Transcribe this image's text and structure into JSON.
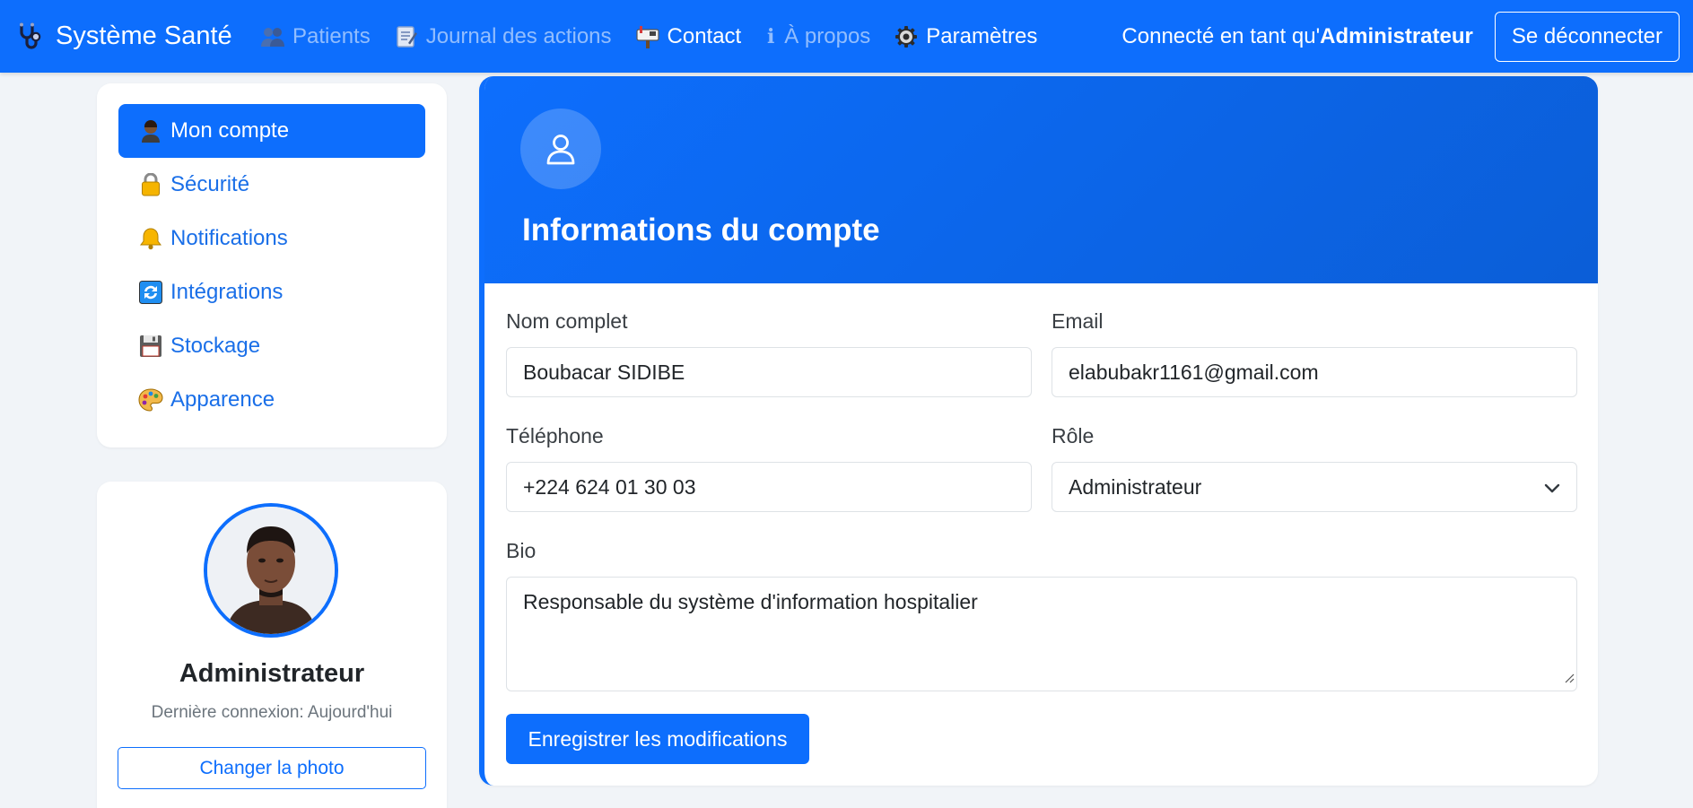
{
  "navbar": {
    "brand_title": "Système Santé",
    "brand_icon": "stethoscope-icon",
    "links": [
      {
        "label": "Patients",
        "icon": "users-icon"
      },
      {
        "label": "Journal des actions",
        "icon": "memo-icon"
      },
      {
        "label": "Contact",
        "icon": "mailbox-icon"
      },
      {
        "label": "À propos",
        "icon": "info-icon"
      },
      {
        "label": "Paramètres",
        "icon": "gear-icon"
      }
    ],
    "logged_prefix": "Connecté en tant qu'",
    "logged_user": "Administrateur",
    "logout_label": "Se déconnecter",
    "colors": {
      "primary": "#0d6efd"
    }
  },
  "sidebar": {
    "menu": [
      {
        "label": "Mon compte",
        "icon": "user-icon",
        "active": true
      },
      {
        "label": "Sécurité",
        "icon": "lock-icon",
        "active": false
      },
      {
        "label": "Notifications",
        "icon": "bell-icon",
        "active": false
      },
      {
        "label": "Intégrations",
        "icon": "sync-icon",
        "active": false
      },
      {
        "label": "Stockage",
        "icon": "floppy-disk-icon",
        "active": false
      },
      {
        "label": "Apparence",
        "icon": "palette-icon",
        "active": false
      }
    ],
    "profile": {
      "name": "Administrateur",
      "last_login": "Dernière connexion: Aujourd'hui",
      "change_photo_label": "Changer la photo"
    }
  },
  "account": {
    "title": "Informations du compte",
    "fields": {
      "full_name": {
        "label": "Nom complet",
        "value": "Boubacar SIDIBE"
      },
      "email": {
        "label": "Email",
        "value": "elabubakr1161@gmail.com"
      },
      "phone": {
        "label": "Téléphone",
        "value": "+224 624 01 30 03"
      },
      "role": {
        "label": "Rôle",
        "value": "Administrateur"
      },
      "bio": {
        "label": "Bio",
        "value": "Responsable du système d'information hospitalier"
      }
    },
    "save_label": "Enregistrer les modifications"
  }
}
